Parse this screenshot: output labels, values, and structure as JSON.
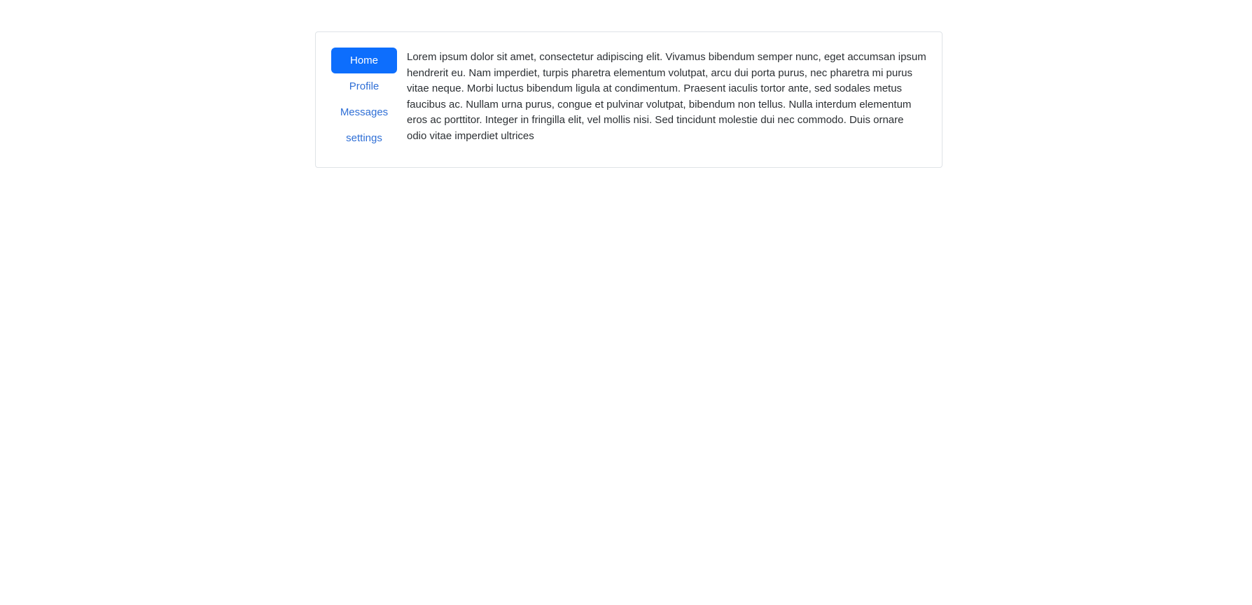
{
  "nav": {
    "items": [
      {
        "label": "Home",
        "active": true
      },
      {
        "label": "Profile",
        "active": false
      },
      {
        "label": "Messages",
        "active": false
      },
      {
        "label": "settings",
        "active": false
      }
    ]
  },
  "content": {
    "text": "Lorem ipsum dolor sit amet, consectetur adipiscing elit. Vivamus bibendum semper nunc, eget accumsan ipsum hendrerit eu. Nam imperdiet, turpis pharetra elementum volutpat, arcu dui porta purus, nec pharetra mi purus vitae neque. Morbi luctus bibendum ligula at condimentum. Praesent iaculis tortor ante, sed sodales metus faucibus ac. Nullam urna purus, congue et pulvinar volutpat, bibendum non tellus. Nulla interdum elementum eros ac porttitor. Integer in fringilla elit, vel mollis nisi. Sed tincidunt molestie dui nec commodo. Duis ornare odio vitae imperdiet ultrices"
  },
  "colors": {
    "accent": "#0d6efd",
    "link": "#2f6fd6",
    "border": "#dfe3e7",
    "text": "#2b2f33"
  }
}
